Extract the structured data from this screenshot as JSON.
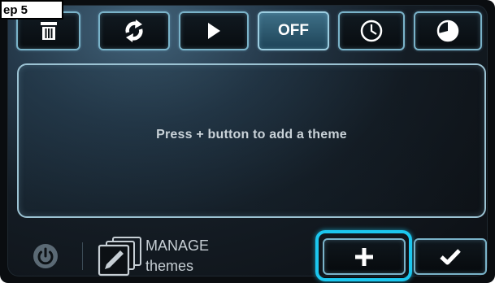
{
  "step_label": "ep 5",
  "toolbar": {
    "buttons": [
      {
        "name": "delete",
        "icon": "trash-icon"
      },
      {
        "name": "refresh",
        "icon": "refresh-icon"
      },
      {
        "name": "play",
        "icon": "play-icon"
      },
      {
        "name": "off",
        "label": "OFF",
        "active": true
      },
      {
        "name": "schedule",
        "icon": "clock-icon"
      },
      {
        "name": "timer",
        "icon": "pie-timer-icon"
      }
    ]
  },
  "panel": {
    "empty_message": "Press + button to add a theme"
  },
  "bottom": {
    "power_icon": "power-icon",
    "manage_line1": "MANAGE",
    "manage_line2": "themes",
    "manage_icon": "edit-layers-icon",
    "add_icon": "plus-icon",
    "confirm_icon": "check-icon"
  },
  "colors": {
    "accent_border": "#7ab3c9",
    "active_button": "#3e6f87",
    "highlight": "#1cc7ef",
    "text": "#c9d2d8"
  }
}
